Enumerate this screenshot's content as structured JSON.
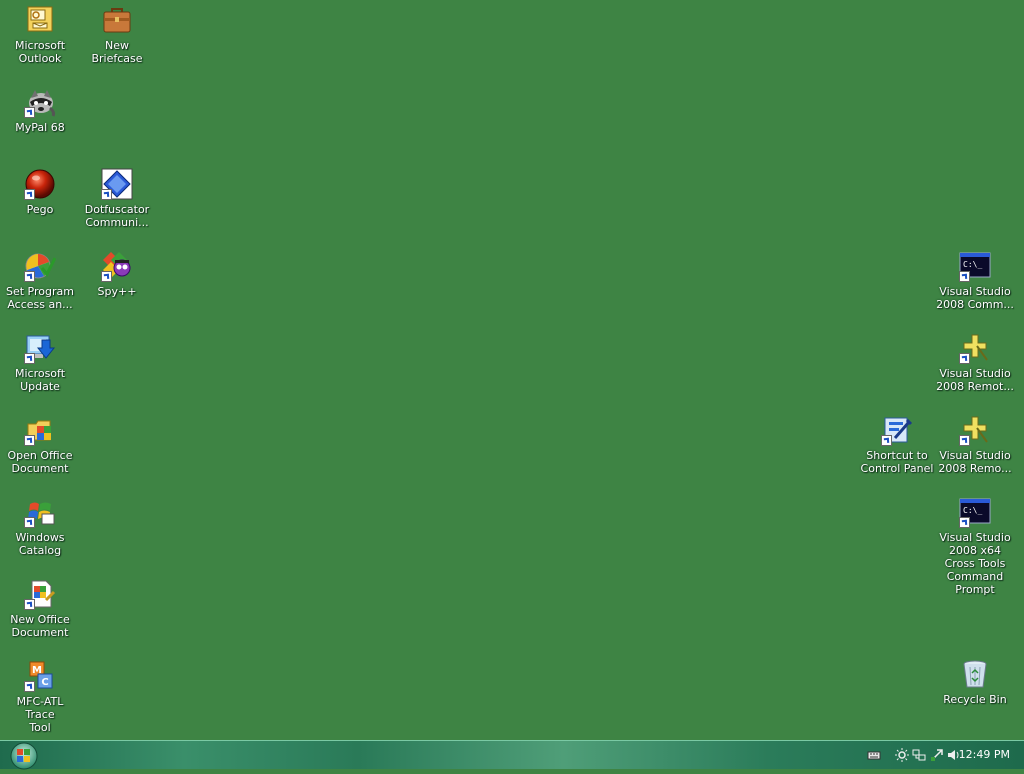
{
  "desktop": {
    "icons": [
      {
        "label": "Microsoft\nOutlook",
        "icon": "outlook-icon"
      },
      {
        "label": "New Briefcase",
        "icon": "briefcase-icon"
      },
      {
        "label": "MyPal 68",
        "icon": "mypal-raccoon-icon"
      },
      {
        "label": "Pego",
        "icon": "pego-icon"
      },
      {
        "label": "Dotfuscator\nCommuni...",
        "icon": "dotfuscator-icon"
      },
      {
        "label": "Set Program\nAccess an...",
        "icon": "set-program-access-icon"
      },
      {
        "label": "Spy++",
        "icon": "spy-plus-plus-icon"
      },
      {
        "label": "Microsoft\nUpdate",
        "icon": "microsoft-update-icon"
      },
      {
        "label": "Open Office\nDocument",
        "icon": "open-office-document-icon"
      },
      {
        "label": "Windows\nCatalog",
        "icon": "windows-catalog-icon"
      },
      {
        "label": "New Office\nDocument",
        "icon": "new-office-document-icon"
      },
      {
        "label": "MFC-ATL Trace\nTool",
        "icon": "mfc-atl-trace-icon"
      },
      {
        "label": "Visual Studio\n2008 Comm...",
        "icon": "command-prompt-icon"
      },
      {
        "label": "Visual Studio\n2008 Remot...",
        "icon": "remote-debugger-icon"
      },
      {
        "label": "Shortcut to\nControl Panel",
        "icon": "control-panel-icon"
      },
      {
        "label": "Visual Studio\n2008 Remo...",
        "icon": "remote-debugger-icon"
      },
      {
        "label": "Visual Studio\n2008 x64\nCross Tools\nCommand\nPrompt",
        "icon": "command-prompt-icon"
      },
      {
        "label": "Recycle Bin",
        "icon": "recycle-bin-icon"
      }
    ]
  },
  "taskbar": {
    "start_icon": "windows-start-orb-icon",
    "tray_icons": [
      "keyboard-icon",
      "sun-icon",
      "network-icon",
      "arrow-icon",
      "speaker-icon"
    ],
    "clock": "12:49 PM"
  },
  "colors": {
    "desktop_background": "#3e8444",
    "taskbar": "#2a7a58"
  }
}
